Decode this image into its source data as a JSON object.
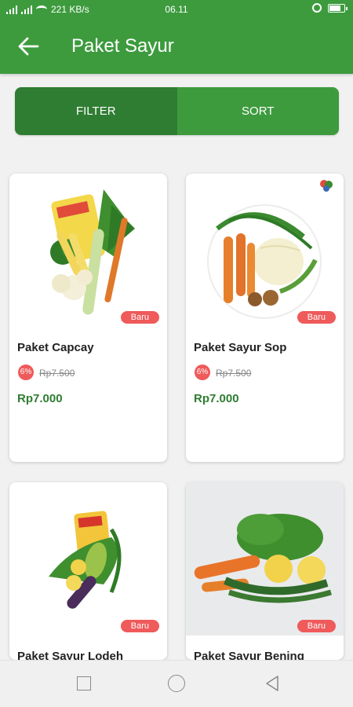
{
  "status_bar": {
    "network": "221 KB/s",
    "time": "06.11",
    "battery_level": 0.85
  },
  "app_bar": {
    "title": "Paket Sayur",
    "back_icon": "arrow-left-icon"
  },
  "segment": {
    "filter_label": "FILTER",
    "sort_label": "SORT"
  },
  "products": [
    {
      "name": "Paket Capcay",
      "badge": "Baru",
      "discount": "6%",
      "old_price": "Rp7.500",
      "price": "Rp7.000"
    },
    {
      "name": "Paket Sayur Sop",
      "badge": "Baru",
      "discount": "6%",
      "old_price": "Rp7.500",
      "price": "Rp7.000"
    },
    {
      "name": "Paket Sayur Lodeh",
      "badge": "Baru"
    },
    {
      "name": "Paket Sayur Bening",
      "badge": "Baru"
    }
  ],
  "colors": {
    "primary": "#3d9b3e",
    "primary_dark": "#2f7d32",
    "badge": "#ef5a5a",
    "price": "#2e7d32"
  },
  "nav_bar": {
    "icons": [
      "recent-apps-icon",
      "home-icon",
      "back-triangle-icon"
    ]
  }
}
